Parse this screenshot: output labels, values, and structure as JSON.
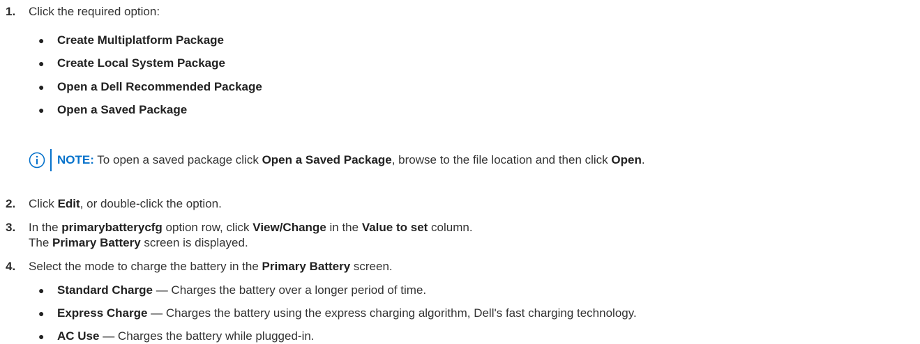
{
  "accent": "#0672cb",
  "step1": {
    "number": "1.",
    "intro": "Click the required option:",
    "options": [
      "Create Multiplatform Package",
      "Create Local System Package",
      "Open a Dell Recommended Package",
      "Open a Saved Package"
    ],
    "note": {
      "icon": "info-icon",
      "label": "NOTE:",
      "text_a": " To open a saved package click ",
      "bold_a": "Open a Saved Package",
      "text_b": ", browse to the file location and then click ",
      "bold_b": "Open",
      "text_c": "."
    }
  },
  "step2": {
    "number": "2.",
    "text_a": "Click ",
    "bold_a": "Edit",
    "text_b": ", or double-click the option."
  },
  "step3": {
    "number": "3.",
    "text_a": "In the ",
    "bold_a": "primarybatterycfg",
    "text_b": " option row, click ",
    "bold_b": "View/Change",
    "text_c": " in the ",
    "bold_c": "Value to set",
    "text_d": " column.",
    "line2_a": "The ",
    "line2_bold": "Primary Battery",
    "line2_b": " screen is displayed."
  },
  "step4": {
    "number": "4.",
    "text_a": "Select the mode to charge the battery in the ",
    "bold_a": "Primary Battery",
    "text_b": " screen.",
    "modes": [
      {
        "name": "Standard Charge",
        "desc": " — Charges the battery over a longer period of time."
      },
      {
        "name": "Express Charge",
        "desc": " — Charges the battery using the express charging algorithm, Dell's fast charging technology."
      },
      {
        "name": "AC Use",
        "desc": " — Charges the battery while plugged-in."
      }
    ]
  }
}
